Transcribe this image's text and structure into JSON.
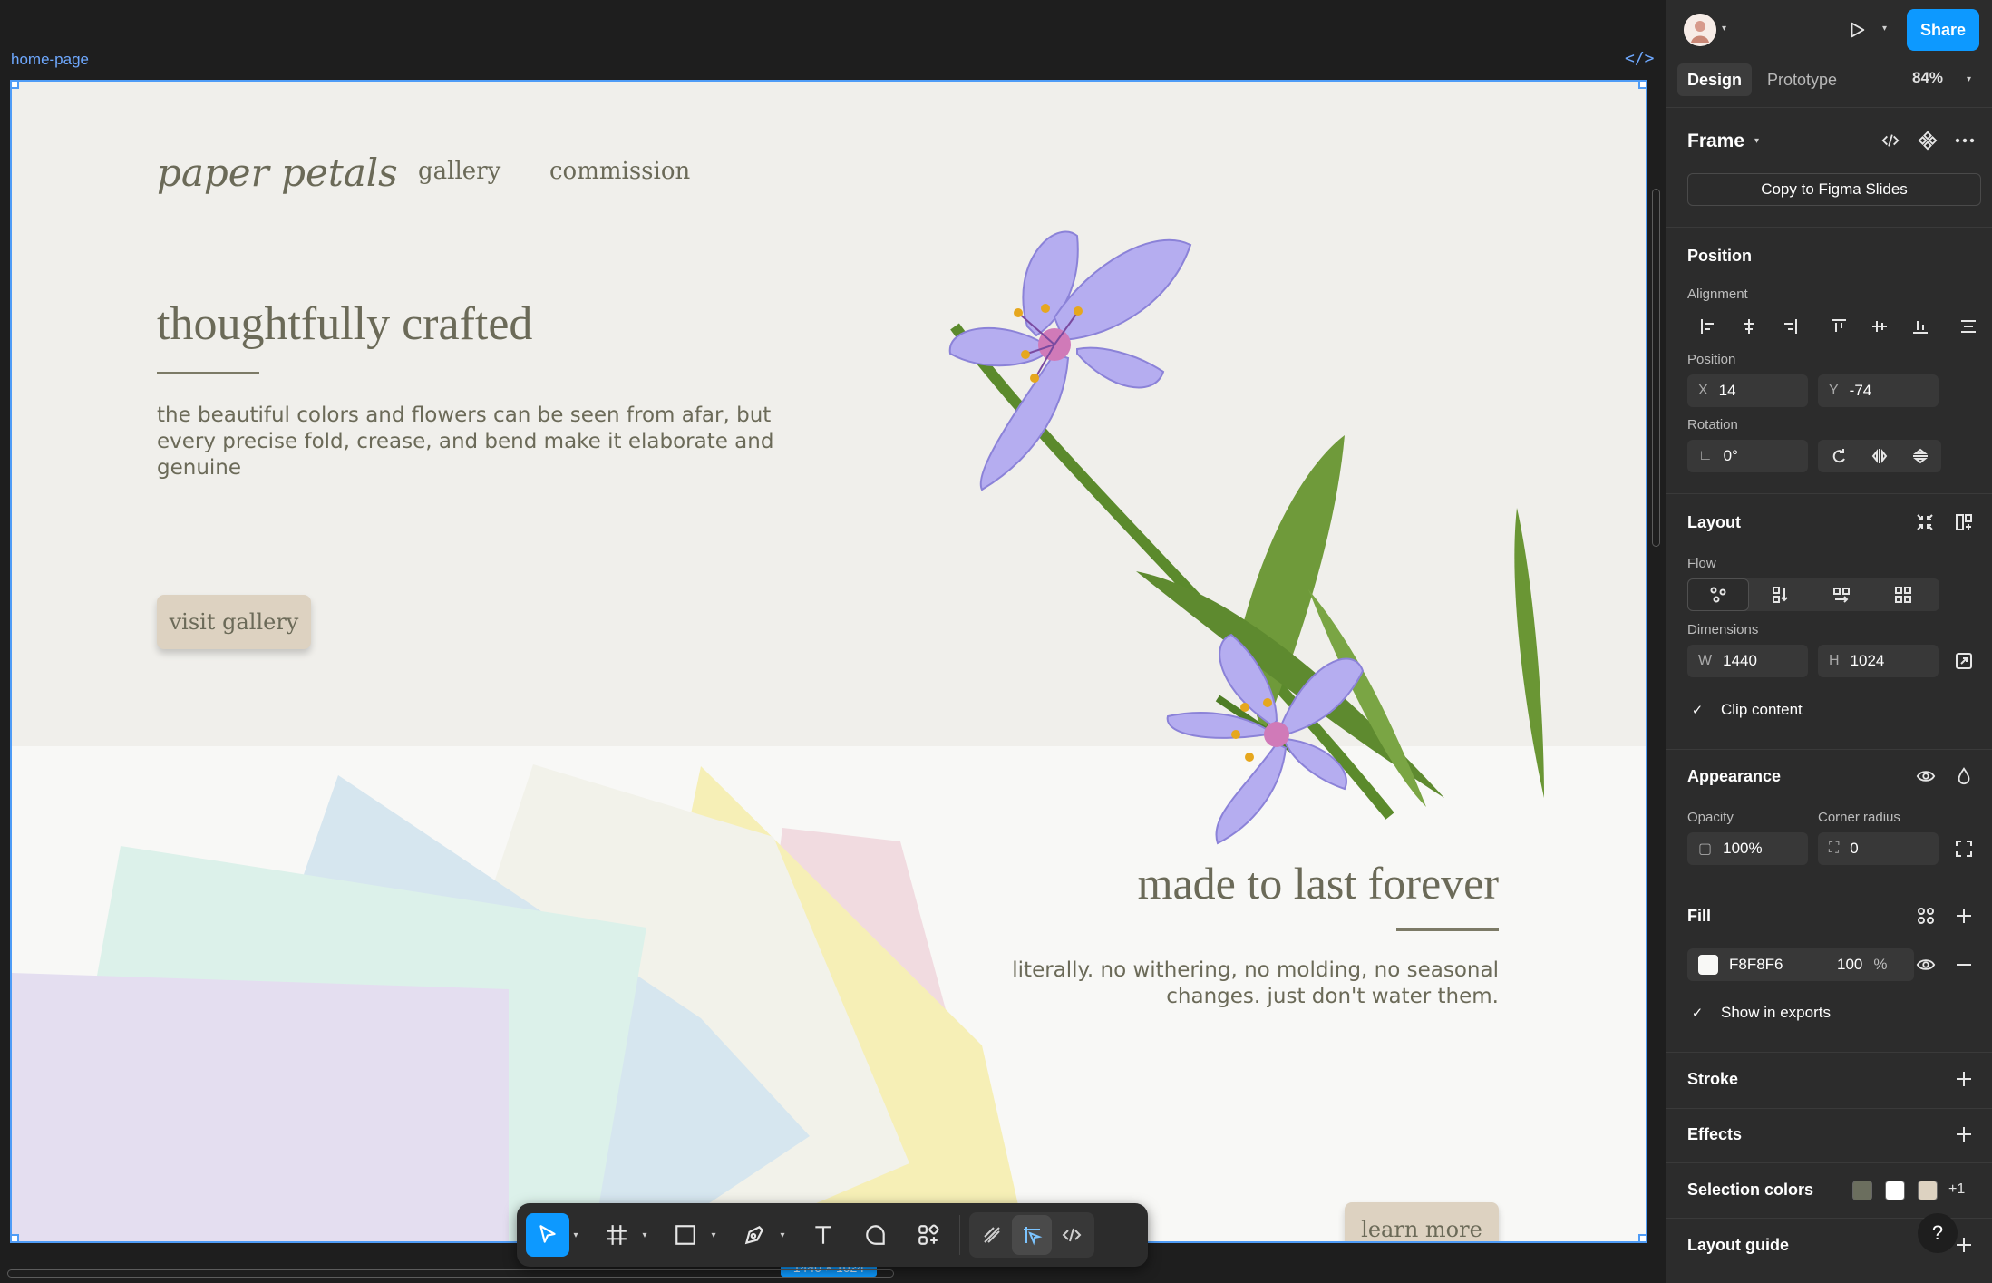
{
  "canvas": {
    "frame_label": "home-page",
    "frame_code_icon": "code-icon",
    "dimension_label": "1440 × 1024"
  },
  "site": {
    "logo": "paper petals",
    "nav": [
      "gallery",
      "commission"
    ],
    "hero_title": "thoughtfully crafted",
    "hero_text": "the beautiful colors and flowers can be seen from afar, but every precise fold, crease, and bend make it elaborate and genuine",
    "hero_button": "visit gallery",
    "lower_title": "made to last forever",
    "lower_text": "literally. no withering, no molding, no seasonal changes. just don't water them.",
    "lower_button": "learn more",
    "colors": {
      "hero_bg": "#F0EFEB",
      "lower_bg": "#F8F8F6",
      "text": "#6B6A58",
      "button": "#DDD2C1"
    }
  },
  "toolbar": {
    "tools": [
      "move-tool",
      "frame-tool",
      "shape-tool",
      "pen-tool",
      "text-tool",
      "comment-tool",
      "actions-tool"
    ],
    "modes": [
      "draw-mode",
      "design-mode",
      "dev-mode"
    ]
  },
  "panel": {
    "share": "Share",
    "tabs": [
      "Design",
      "Prototype"
    ],
    "zoom": "84%",
    "frame_title": "Frame",
    "copy_button": "Copy to Figma Slides",
    "position": {
      "title": "Position",
      "alignment_label": "Alignment",
      "position_label": "Position",
      "x_label": "X",
      "x": "14",
      "y_label": "Y",
      "y": "-74",
      "rotation_label": "Rotation",
      "rotation": "0°"
    },
    "layout": {
      "title": "Layout",
      "flow_label": "Flow",
      "dimensions_label": "Dimensions",
      "w_label": "W",
      "w": "1440",
      "h_label": "H",
      "h": "1024",
      "clip_content": "Clip content"
    },
    "appearance": {
      "title": "Appearance",
      "opacity_label": "Opacity",
      "opacity": "100%",
      "radius_label": "Corner radius",
      "radius": "0"
    },
    "fill": {
      "title": "Fill",
      "hex": "F8F8F6",
      "opacity": "100",
      "percent": "%",
      "show_in_exports": "Show in exports"
    },
    "stroke": "Stroke",
    "effects": "Effects",
    "selection_colors": {
      "title": "Selection colors",
      "colors": [
        "#6B6E5E",
        "#FFFFFF",
        "#DDD2C1"
      ],
      "more": "+1"
    },
    "layout_guide": "Layout guide",
    "help": "?"
  }
}
